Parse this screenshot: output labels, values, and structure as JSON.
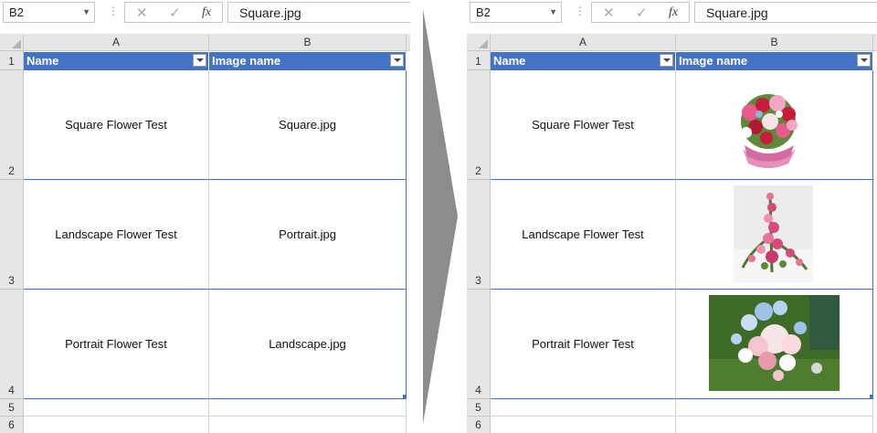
{
  "formula_bar": {
    "name_box": "B2",
    "formula_sep": "⋮",
    "cancel_glyph": "✕",
    "enter_glyph": "✓",
    "fx_label": "fx",
    "formula_value": "Square.jpg"
  },
  "columns": [
    "A",
    "B"
  ],
  "rows": [
    "1",
    "2",
    "3",
    "4",
    "5",
    "6"
  ],
  "table": {
    "headers": [
      "Name",
      "Image name"
    ],
    "header_color": "#4472c4",
    "before": [
      {
        "name": "Square Flower Test",
        "image": "Square.jpg"
      },
      {
        "name": "Landscape Flower Test",
        "image": "Portrait.jpg"
      },
      {
        "name": "Portrait Flower Test",
        "image": "Landscape.jpg"
      }
    ],
    "after": [
      {
        "name": "Square Flower Test",
        "image_icon": "flower-bouquet-square-image"
      },
      {
        "name": "Landscape Flower Test",
        "image_icon": "flower-arrangement-portrait-image"
      },
      {
        "name": "Portrait Flower Test",
        "image_icon": "flower-bouquet-landscape-image"
      }
    ]
  },
  "arrow_color": "#8c8c8c"
}
